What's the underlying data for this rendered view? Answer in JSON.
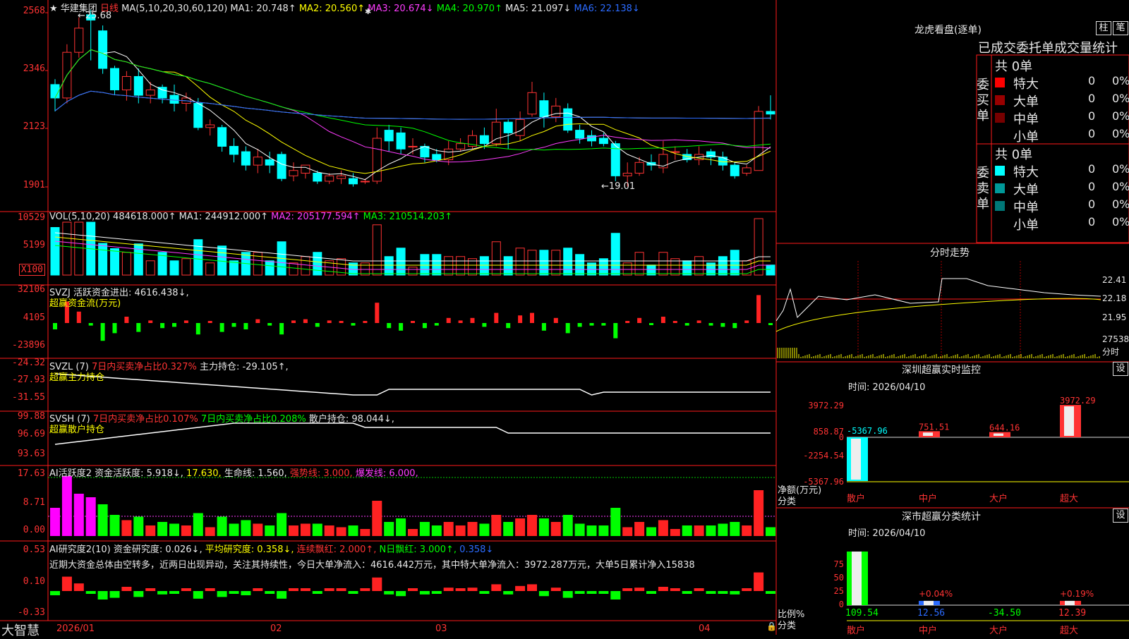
{
  "stock": {
    "star": "★",
    "name": "华建集团",
    "period": "日线",
    "ma_label": "MA(5,10,20,30,60,120)",
    "ma1": "MA1: 20.748↑",
    "ma2": "MA2: 20.560↑",
    "ma3": "MA3: 20.674↓",
    "ma4": "MA4: 20.970↑",
    "ma5": "MA5: 21.097↓",
    "ma6": "MA6: 22.138↓",
    "high_label": "←25.68",
    "low_label": "←19.01",
    "star_mark": "✱"
  },
  "price_axis": [
    "2568",
    "2346",
    "2123",
    "1901"
  ],
  "vol": {
    "label": "VOL(5,10,20)",
    "value": "484618.000↑",
    "ma1": "MA1: 244912.000↑",
    "ma2": "MA2: 205177.594↑",
    "ma3": "MA3: 210514.203↑",
    "axis": [
      "10529",
      "5199"
    ],
    "unit": "X100"
  },
  "svzj": {
    "label": "SVZJ",
    "text": "活跃资金进出: 4616.438↓,",
    "sub": "超赢资金流(万元)",
    "axis": [
      "32106",
      "4105",
      "-23896"
    ]
  },
  "svzl": {
    "label": "SVZL (7)",
    "t1": "7日内买卖净占比0.327%",
    "t2": "主力持仓: -29.105↑,",
    "sub": "超赢主力持仓",
    "axis": [
      "-24.32",
      "-27.93",
      "-31.55"
    ]
  },
  "svsh": {
    "label": "SVSH (7)",
    "t1": "7日内买卖净占比0.107%",
    "t2": "7日内买卖净占比0.208%",
    "t3": "散户持仓: 98.044↓,",
    "sub": "超赢散户持仓",
    "axis": [
      "99.88",
      "96.69",
      "93.63"
    ]
  },
  "ai1": {
    "label": "AI活跃度2",
    "t1": "资金活跃度: 5.918↓,",
    "t2": "17.630,",
    "t3": "生命线: 1.560,",
    "t4": "强势线: 3.000,",
    "t5": "爆发线: 6.000,",
    "axis": [
      "17.63",
      "8.71",
      "0.00"
    ]
  },
  "ai2": {
    "label": "AI研究度2(10)",
    "t1": "资金研究度: 0.026↓,",
    "t2": "平均研究度: 0.358↓,",
    "t3": "连续飘红: 2.000↑,",
    "t4": "N日飘红: 3.000↑,",
    "t5": "0.358↓",
    "desc": "近期大资金总体由空转多，近两日出现异动，关注其持续性，今日大单净流入：4616.442万元，其中特大单净流入：3972.287万元，大单5日累计净入15838",
    "axis": [
      "0.53",
      "0.10",
      "-0.33"
    ]
  },
  "bottom": {
    "brand": "大智慧",
    "dates": [
      "2026/01",
      "02",
      "03",
      "04"
    ]
  },
  "dragon": {
    "title": "龙虎看盘(逐单)",
    "btn1": "柱",
    "btn2": "笔",
    "header": "已成交委托单成交量统计",
    "buy_side": "委买单",
    "sell_side": "委卖单",
    "buy_total": "共 0单",
    "sell_total": "共 0单",
    "rows": [
      {
        "name": "特大",
        "n": "0",
        "p": "0%"
      },
      {
        "name": "大单",
        "n": "0",
        "p": "0%"
      },
      {
        "name": "中单",
        "n": "0",
        "p": "0%"
      },
      {
        "name": "小单",
        "n": "0",
        "p": "0%"
      }
    ],
    "buy_colors": [
      "#ff0000",
      "#990000",
      "#770000"
    ],
    "sell_colors": [
      "#00ffff",
      "#009999",
      "#007777"
    ]
  },
  "fenshi": {
    "title": "分时走势",
    "axis": [
      "22.41",
      "22.18",
      "21.95",
      "27538"
    ],
    "unit": "分时"
  },
  "sz_monitor": {
    "title": "深圳超赢实时监控",
    "btn": "设",
    "time": "时间: 2026/04/10",
    "axis": [
      "3972.29",
      "858.87",
      "0",
      "-2254.54",
      "-5367.96"
    ],
    "ylabel": "净额(万元)",
    "xlabel": "分类",
    "cats": [
      "散户",
      "中户",
      "大户",
      "超大"
    ],
    "values": [
      "-5367.96",
      "751.51",
      "644.16",
      "3972.29"
    ]
  },
  "sz_class": {
    "title": "深市超赢分类统计",
    "btn": "设",
    "time": "时间: 2026/04/10",
    "axis": [
      "75",
      "50",
      "25",
      "0"
    ],
    "ylabel": "比例%",
    "xlabel": "分类",
    "cats": [
      "散户",
      "中户",
      "大户",
      "超大"
    ],
    "values": [
      "109.54",
      "12.56",
      "-34.50",
      "12.39"
    ],
    "pct": [
      "+0.04%",
      "+0.19%"
    ]
  },
  "chart_data": {
    "type": "candlestick",
    "title": "华建集团 日线",
    "x": [
      "2026/01",
      "02",
      "03",
      "04"
    ],
    "price_range": [
      19.01,
      25.68
    ],
    "ma_last": {
      "MA1": 20.748,
      "MA2": 20.56,
      "MA3": 20.674,
      "MA4": 20.97,
      "MA5": 21.097,
      "MA6": 22.138
    },
    "candles": [
      [
        22.9,
        22.4,
        23.1,
        21.9
      ],
      [
        22.4,
        24.1,
        24.4,
        22.2
      ],
      [
        24.1,
        25.0,
        25.4,
        23.9
      ],
      [
        25.5,
        25.3,
        25.68,
        23.8
      ],
      [
        24.9,
        23.5,
        25.1,
        23.3
      ],
      [
        23.5,
        22.7,
        23.6,
        22.5
      ],
      [
        22.7,
        23.2,
        23.4,
        22.3
      ],
      [
        23.2,
        22.5,
        23.5,
        22.2
      ],
      [
        22.5,
        22.7,
        23.0,
        22.2
      ],
      [
        22.8,
        22.4,
        22.9,
        22.2
      ],
      [
        22.5,
        22.2,
        22.9,
        21.9
      ],
      [
        22.2,
        22.4,
        22.6,
        21.9
      ],
      [
        22.2,
        21.3,
        22.4,
        21.2
      ],
      [
        21.3,
        21.4,
        21.6,
        21.0
      ],
      [
        21.3,
        20.6,
        21.4,
        20.4
      ],
      [
        20.6,
        20.3,
        20.9,
        20.0
      ],
      [
        20.4,
        19.9,
        20.6,
        19.7
      ],
      [
        19.9,
        20.2,
        20.5,
        19.6
      ],
      [
        20.1,
        19.9,
        20.4,
        19.6
      ],
      [
        20.3,
        19.4,
        20.4,
        19.3
      ],
      [
        19.5,
        19.7,
        20.0,
        19.3
      ],
      [
        19.6,
        19.9,
        19.9,
        19.4
      ],
      [
        19.6,
        19.3,
        19.7,
        19.2
      ],
      [
        19.3,
        19.5,
        19.6,
        19.2
      ],
      [
        19.4,
        19.5,
        19.7,
        19.2
      ],
      [
        19.4,
        19.2,
        19.6,
        19.1
      ],
      [
        19.3,
        19.3,
        19.4,
        19.2
      ],
      [
        19.3,
        20.9,
        21.3,
        19.2
      ],
      [
        21.2,
        20.8,
        21.4,
        20.4
      ],
      [
        21.1,
        20.5,
        21.3,
        20.3
      ],
      [
        20.6,
        20.6,
        20.9,
        20.3
      ],
      [
        20.6,
        20.2,
        20.7,
        20.0
      ],
      [
        20.3,
        20.1,
        20.5,
        20.0
      ],
      [
        20.1,
        20.5,
        20.8,
        19.9
      ],
      [
        20.5,
        20.7,
        20.9,
        20.4
      ],
      [
        20.6,
        21.0,
        21.2,
        20.5
      ],
      [
        21.0,
        20.7,
        21.3,
        20.5
      ],
      [
        20.7,
        21.5,
        22.0,
        20.6
      ],
      [
        21.5,
        21.1,
        21.6,
        20.5
      ],
      [
        21.0,
        21.6,
        21.9,
        20.8
      ],
      [
        21.8,
        22.6,
        23.0,
        21.7
      ],
      [
        22.3,
        21.7,
        22.6,
        21.3
      ],
      [
        21.7,
        22.1,
        22.4,
        21.5
      ],
      [
        22.0,
        21.2,
        22.2,
        21.1
      ],
      [
        21.2,
        20.9,
        21.4,
        20.7
      ],
      [
        21.0,
        20.8,
        21.2,
        20.6
      ],
      [
        20.9,
        20.7,
        21.1,
        20.6
      ],
      [
        20.7,
        19.5,
        20.8,
        19.3
      ],
      [
        19.5,
        19.6,
        20.0,
        19.1
      ],
      [
        19.6,
        20.0,
        20.2,
        19.5
      ],
      [
        20.0,
        19.9,
        20.3,
        19.7
      ],
      [
        19.8,
        20.3,
        20.8,
        19.6
      ],
      [
        20.4,
        20.4,
        20.6,
        20.1
      ],
      [
        20.3,
        20.1,
        20.5,
        20.0
      ],
      [
        20.1,
        20.3,
        20.6,
        19.9
      ],
      [
        20.4,
        20.2,
        20.5,
        19.9
      ],
      [
        20.2,
        19.9,
        20.4,
        19.7
      ],
      [
        19.9,
        19.5,
        20.0,
        19.4
      ],
      [
        19.6,
        19.8,
        19.9,
        19.5
      ],
      [
        19.7,
        21.9,
        22.1,
        19.7
      ],
      [
        21.9,
        21.8,
        22.5,
        21.6
      ]
    ]
  }
}
